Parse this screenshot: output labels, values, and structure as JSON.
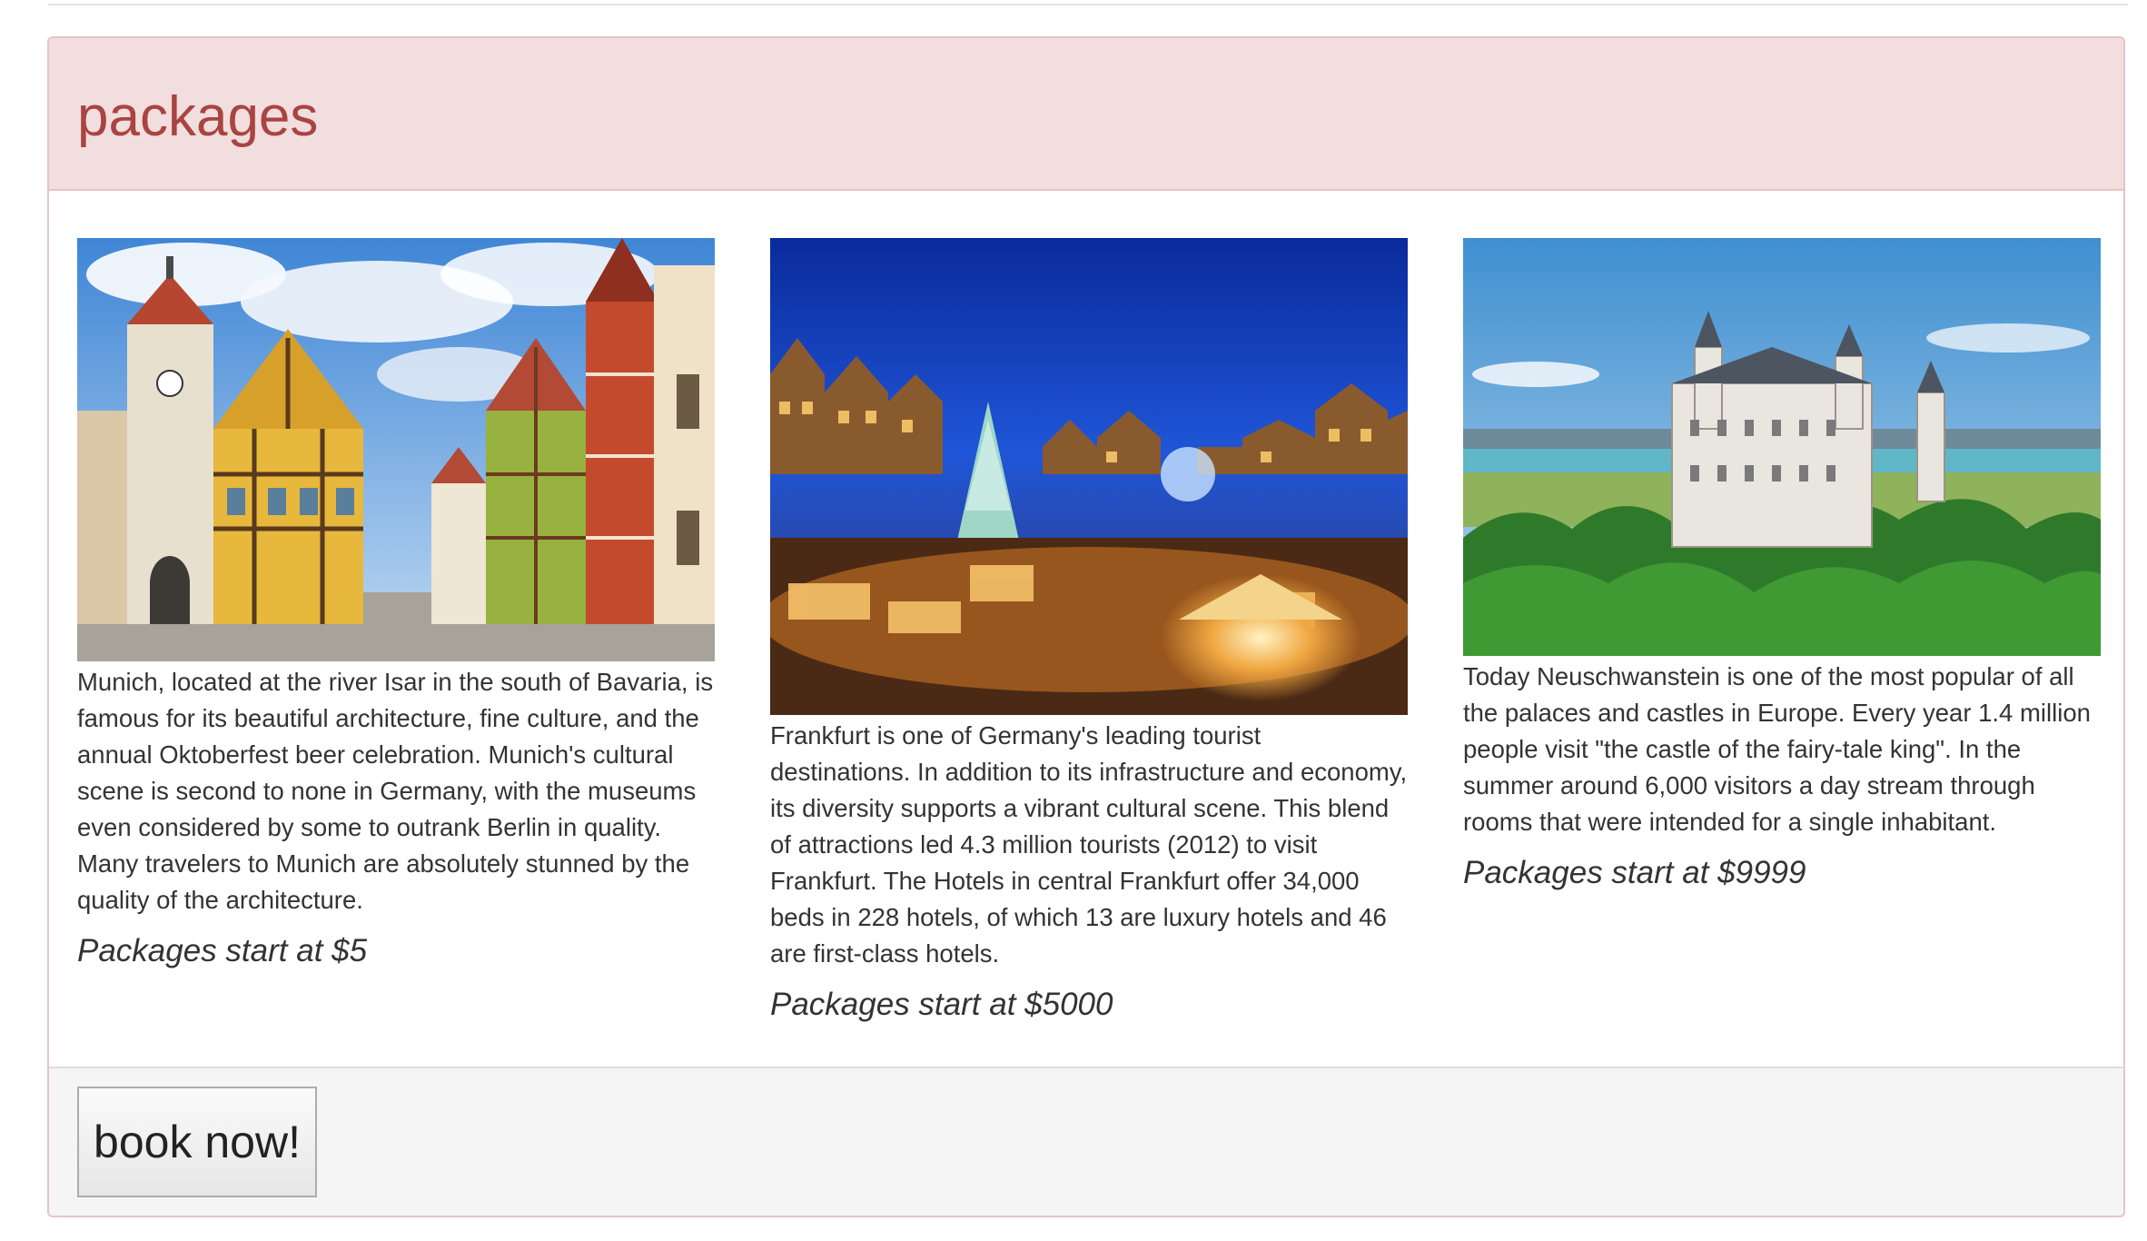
{
  "panel": {
    "title": "packages",
    "footer_button_label": "book now!"
  },
  "packages": [
    {
      "image_name": "munich-old-town-photo",
      "description": "Munich, located at the river Isar in the south of Bavaria, is famous for its beautiful architecture, fine culture, and the annual Oktoberfest beer celebration. Munich's cultural scene is second to none in Germany, with the museums even considered by some to outrank Berlin in quality. Many travelers to Munich are absolutely stunned by the quality of the architecture.",
      "price": "Packages start at $5"
    },
    {
      "image_name": "frankfurt-christmas-market-photo",
      "description": "Frankfurt is one of Germany's leading tourist destinations. In addition to its infrastructure and economy, its diversity supports a vibrant cultural scene. This blend of attractions led 4.3 million tourists (2012) to visit Frankfurt. The Hotels in central Frankfurt offer 34,000 beds in 228 hotels, of which 13 are luxury hotels and 46 are first-class hotels.",
      "price": "Packages start at $5000"
    },
    {
      "image_name": "neuschwanstein-castle-photo",
      "description": "Today Neuschwanstein is one of the most popular of all the palaces and castles in Europe. Every year 1.4 million people visit \"the castle of the fairy-tale king\". In the summer around 6,000 visitors a day stream through rooms that were intended for a single inhabitant.",
      "price": "Packages start at $9999"
    }
  ],
  "colors": {
    "heading_bg": "#f2dede",
    "heading_text": "#a94442",
    "panel_border": "#e7c3c5",
    "footer_bg": "#f5f5f5"
  }
}
